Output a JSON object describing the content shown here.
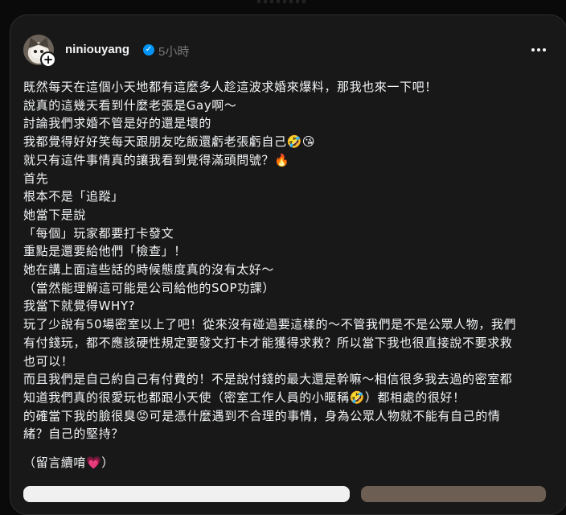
{
  "post": {
    "username": "niniouyang",
    "time": "5小時",
    "lines": [
      "既然每天在這個小天地都有這麼多人趁這波求婚來爆料，那我也來一下吧！",
      "說真的這幾天看到什麼老張是Gay啊～",
      "討論我們求婚不管是好的還是壞的",
      "我都覺得好好笑每天跟朋友吃飯還虧老張虧自己🤣😘",
      "就只有這件事情真的讓我看到覺得滿頭問號？🔥",
      "首先",
      "根本不是「追蹤」",
      "她當下是說",
      "「每個」玩家都要打卡發文",
      "重點是還要給他們「檢查」！",
      "她在講上面這些話的時候態度真的沒有太好～",
      "（當然能理解這可能是公司給他的SOP功課）",
      "我當下就覺得WHY?",
      "玩了少說有50場密室以上了吧！從來沒有碰過要這樣的～不管我們是不是公眾人物，我們",
      "有付錢玩，都不應該硬性規定要發文打卡才能獲得求救？所以當下我也很直接說不要求救",
      "也可以！",
      "而且我們是自己約自己有付費的！不是說付錢的最大還是幹嘛～相信很多我去過的密室都",
      "知道我們真的很愛玩也都跟小天使（密室工作人員的小暱稱🤣）都相處的很好！",
      "的確當下我的臉很臭😡可是憑什麼遇到不合理的事情，身為公眾人物就不能有自己的情",
      "緒？自己的堅持？"
    ],
    "footer_line": "（留言續唷💗）"
  }
}
